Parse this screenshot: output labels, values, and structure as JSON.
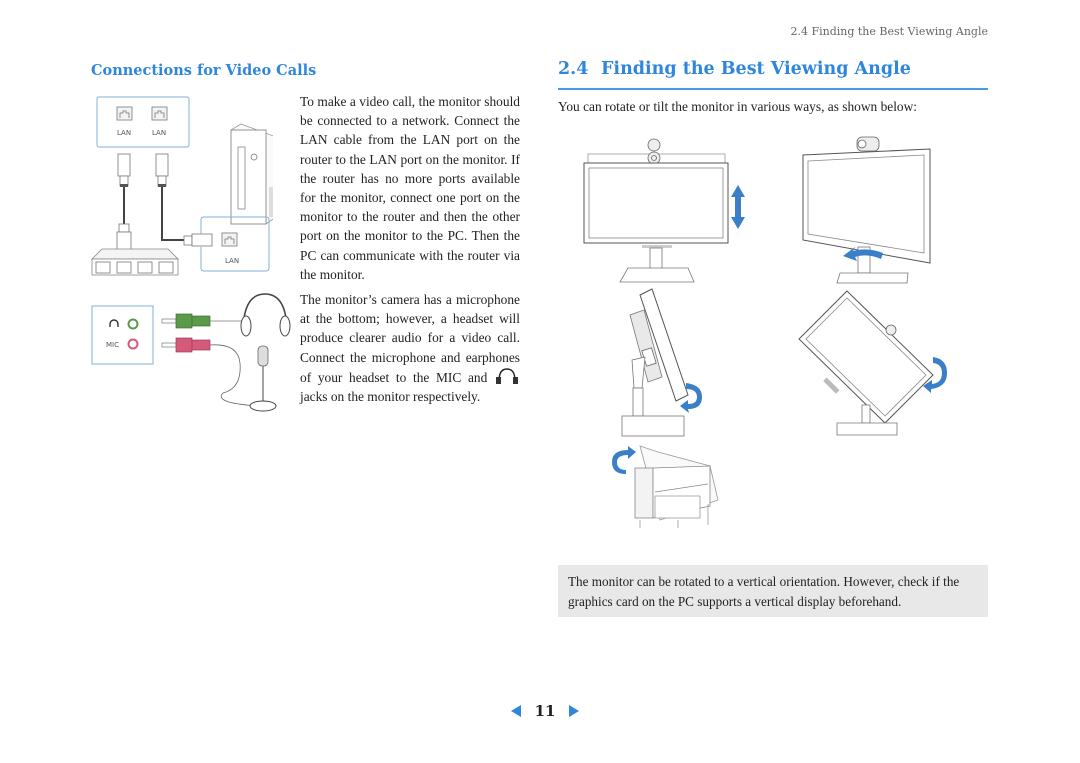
{
  "running_head": "2.4 Finding the Best Viewing Angle",
  "left_column": {
    "heading": "Connections for Video Calls",
    "paragraph1": "To make a video call, the monitor should be connected to a network. Connect the LAN cable from the LAN port on the router to the LAN port on the monitor. If the router has no more ports available for the monitor, connect one port on the monitor to the router and then the other port on the monitor to the PC. Then the PC can communicate with the router via the monitor.",
    "paragraph2_before_icon": "The monitor’s camera has a microphone at the bottom; however, a headset will produce clearer audio for a video call.  Connect the microphone and earphones of your headset to the MIC and ",
    "paragraph2_after_icon": " jacks on the monitor respectively.",
    "lan_diagram": {
      "monitor_port_labels": [
        "LAN",
        "LAN"
      ],
      "pc_port_label": "LAN",
      "icons": [
        "lan-port-icon",
        "rj45-plug-icon",
        "router-icon",
        "pc-tower-icon"
      ]
    },
    "audio_diagram": {
      "jack_labels": [
        "headphone-symbol",
        "MIC"
      ],
      "colors": {
        "headphone_plug": "#5a9a4a",
        "mic_plug": "#d45a7a"
      },
      "icons": [
        "headphones-icon",
        "microphone-icon"
      ]
    }
  },
  "right_column": {
    "section_number": "2.4",
    "section_title": "Finding the Best Viewing Angle",
    "intro": "You can rotate or tilt the monitor in various ways, as shown below:",
    "figures": [
      {
        "name": "height-adjust",
        "arrow": "up-down"
      },
      {
        "name": "swivel",
        "arrow": "horizontal-curve"
      },
      {
        "name": "tilt",
        "arrow": "curved"
      },
      {
        "name": "pivot",
        "arrow": "curved"
      },
      {
        "name": "camera-tilt",
        "arrow": "curved"
      }
    ],
    "note": "The monitor can be rotated to a vertical orientation. However, check if the graphics card on the PC supports a vertical display beforehand."
  },
  "pager": {
    "page_number": "11",
    "prev_label": "previous-page",
    "next_label": "next-page"
  },
  "colors": {
    "accent": "#2f86dd",
    "arrow_blue": "#3a7fc8",
    "note_bg": "#e8e8e8"
  }
}
